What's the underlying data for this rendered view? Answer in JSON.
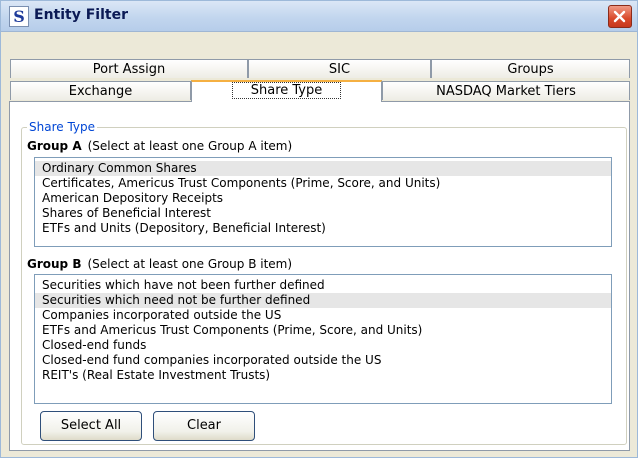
{
  "window": {
    "title": "Entity Filter",
    "app_icon_glyph": "S"
  },
  "tabs_back_row": [
    "Port Assign",
    "SIC",
    "Groups"
  ],
  "tabs_front_row": [
    "Exchange",
    "Share Type",
    "NASDAQ Market Tiers"
  ],
  "active_tab": "Share Type",
  "section": {
    "legend": "Share Type"
  },
  "group_a": {
    "name": "Group A",
    "hint": "(Select at least one Group A item)",
    "items": [
      "Ordinary Common Shares",
      "Certificates, Americus Trust Components (Prime, Score, and Units)",
      "American Depository Receipts",
      "Shares of Beneficial Interest",
      "ETFs and Units (Depository, Beneficial Interest)"
    ],
    "selected": "Ordinary Common Shares"
  },
  "group_b": {
    "name": "Group B",
    "hint": "(Select at least one Group B item)",
    "items": [
      "Securities which have not been further defined",
      "Securities which need not be further defined",
      "Companies incorporated outside the US",
      "ETFs and Americus Trust Components (Prime, Score, and Units)",
      "Closed-end funds",
      "Closed-end fund companies incorporated outside the US",
      "REIT's (Real Estate Investment Trusts)"
    ],
    "selected": "Securities which need not be further defined"
  },
  "buttons": {
    "select_all": "Select All",
    "clear": "Clear"
  },
  "colors": {
    "accent_tab": "#f5b042",
    "legend": "#0046d5",
    "close": "#d9492a"
  }
}
